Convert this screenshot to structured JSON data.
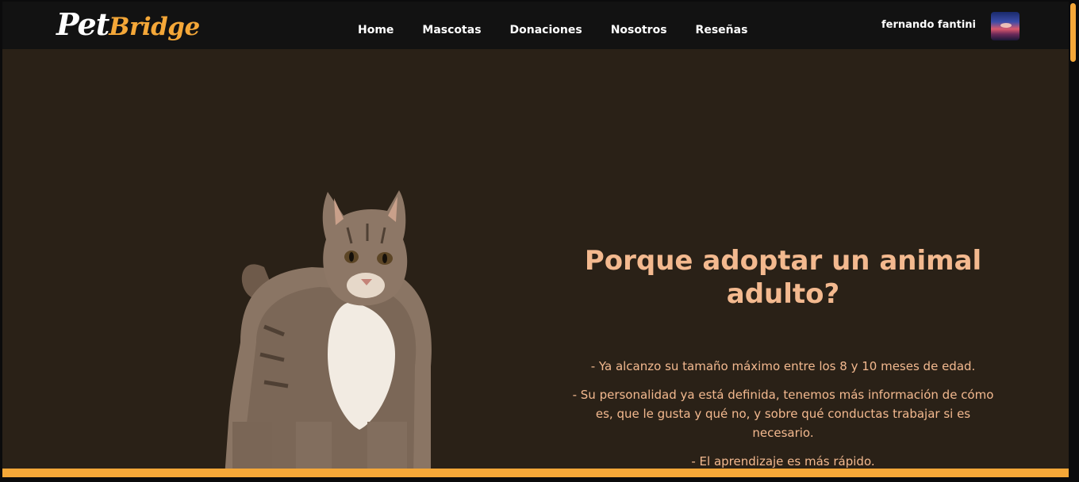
{
  "brand": {
    "part1": "Pet",
    "part2": "Bridge"
  },
  "nav": {
    "items": [
      {
        "label": "Home"
      },
      {
        "label": "Mascotas"
      },
      {
        "label": "Donaciones"
      },
      {
        "label": "Nosotros"
      },
      {
        "label": "Reseñas"
      }
    ]
  },
  "user": {
    "name": "fernando fantini",
    "avatar_icon": "user-avatar-icon"
  },
  "hero": {
    "image_icon": "cat-icon",
    "heading": "Porque adoptar un animal adulto?",
    "bullets": [
      "- Ya alcanzo su tamaño máximo entre los 8 y 10 meses de edad.",
      "- Su personalidad ya está definida, tenemos más información de cómo es, que le gusta y qué no, y sobre qué conductas trabajar si es necesario.",
      "- El aprendizaje es más rápido."
    ]
  },
  "colors": {
    "accent": "#f4a738",
    "heading": "#f3b98f",
    "background": "#2a2117",
    "navbar": "#121212"
  }
}
